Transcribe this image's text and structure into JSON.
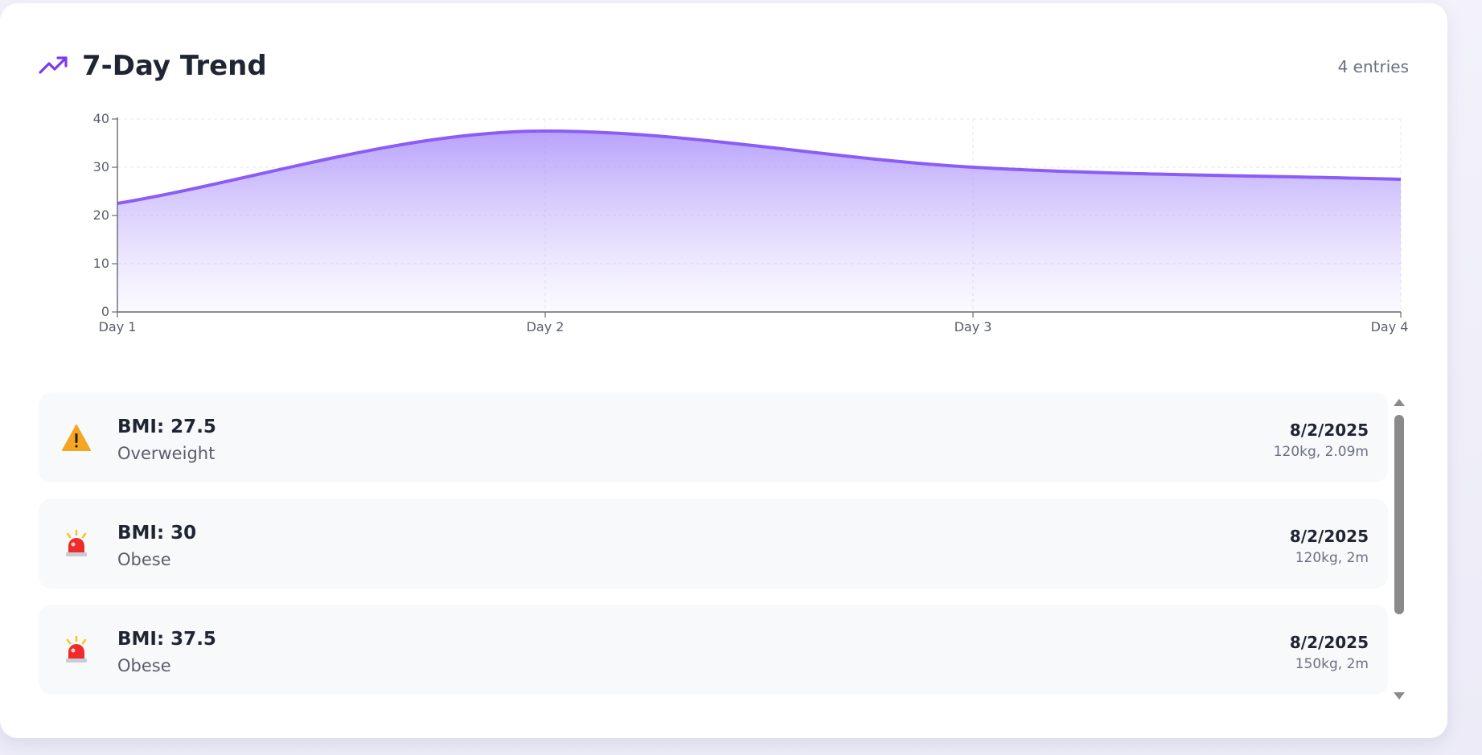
{
  "header": {
    "title": "7-Day Trend",
    "entries_label": "4 entries",
    "icon": "trending-up-icon",
    "accent_color": "#8b5cf6"
  },
  "chart_data": {
    "type": "area",
    "x": [
      "Day 1",
      "Day 2",
      "Day 3",
      "Day 4"
    ],
    "series": [
      {
        "values": [
          22.5,
          37.5,
          30,
          27.5
        ]
      }
    ],
    "y_ticks": [
      0,
      10,
      20,
      30,
      40
    ],
    "ylim": [
      0,
      40
    ],
    "grid": true,
    "line_color": "#8b5cf6",
    "fill_color": "#c4b5fd"
  },
  "history": {
    "items": [
      {
        "bmi_label": "BMI: 27.5",
        "category": "Overweight",
        "date": "8/2/2025",
        "details": "120kg, 2.09m",
        "icon": "warning-icon",
        "status_color": "#f5a524"
      },
      {
        "bmi_label": "BMI: 30",
        "category": "Obese",
        "date": "8/2/2025",
        "details": "120kg, 2m",
        "icon": "siren-icon",
        "status_color": "#ef2b2b"
      },
      {
        "bmi_label": "BMI: 37.5",
        "category": "Obese",
        "date": "8/2/2025",
        "details": "150kg, 2m",
        "icon": "siren-icon",
        "status_color": "#ef2b2b"
      }
    ]
  }
}
